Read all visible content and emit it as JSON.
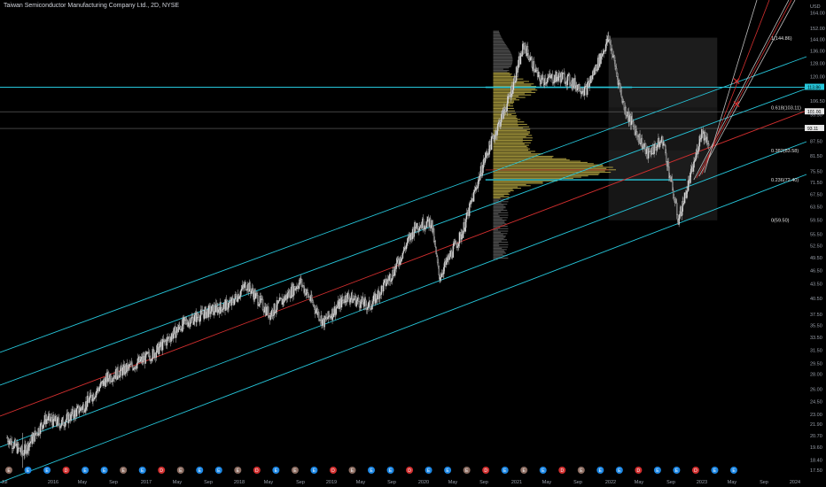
{
  "header": {
    "title": "Taiwan Semiconductor Manufacturing Company Ltd., 2D, NYSE"
  },
  "colors": {
    "background": "#000000",
    "channel": "#26c6da",
    "midline": "#d32f2f",
    "fib_box": "#1a1a1a",
    "volume_profile": "#b5a642",
    "volume_profile_low": "#5a5a5a",
    "candles": "#c8c8c8",
    "tag_cyan": "#26c6da",
    "tag_white": "#e6e6e6",
    "event_blue": "#2962ff",
    "event_red": "#d32f2f"
  },
  "chart_data": {
    "type": "candlestick",
    "title": "Taiwan Semiconductor Manufacturing Company Ltd., 2D, NYSE",
    "y_scale": "log",
    "ylim": [
      17.5,
      170
    ],
    "y_currency_label": "USD",
    "y_ticks": [
      "164.00",
      "152.00",
      "144.00",
      "136.00",
      "128.00",
      "120.00",
      "113.86",
      "106.50",
      "101.00",
      "99.50",
      "93.11",
      "87.50",
      "81.50",
      "75.50",
      "71.50",
      "67.50",
      "63.50",
      "59.50",
      "55.50",
      "52.50",
      "49.50",
      "46.50",
      "43.50",
      "40.50",
      "37.50",
      "35.50",
      "33.50",
      "31.50",
      "29.50",
      "28.00",
      "26.00",
      "24.50",
      "23.00",
      "21.90",
      "20.70",
      "19.60",
      "18.40",
      "17.50"
    ],
    "x_ticks": [
      "Jul",
      "2016",
      "May",
      "Sep",
      "2017",
      "May",
      "Sep",
      "2018",
      "May",
      "Sep",
      "2019",
      "May",
      "Sep",
      "2020",
      "May",
      "Sep",
      "2021",
      "May",
      "Sep",
      "2022",
      "May",
      "Sep",
      "2023",
      "May",
      "Sep",
      "2024"
    ],
    "x_range": [
      "2015-07",
      "2024-01"
    ],
    "price_path": [
      [
        "2015-07",
        20.5
      ],
      [
        "2015-09",
        19.0
      ],
      [
        "2015-12",
        22.5
      ],
      [
        "2016-02",
        22.0
      ],
      [
        "2016-05",
        24.0
      ],
      [
        "2016-08",
        27.5
      ],
      [
        "2016-11",
        29.0
      ],
      [
        "2017-02",
        31.0
      ],
      [
        "2017-06",
        36.0
      ],
      [
        "2017-09",
        38.0
      ],
      [
        "2017-12",
        39.5
      ],
      [
        "2018-02",
        43.5
      ],
      [
        "2018-05",
        37.5
      ],
      [
        "2018-09",
        44.0
      ],
      [
        "2018-12",
        36.0
      ],
      [
        "2019-03",
        41.0
      ],
      [
        "2019-06",
        39.0
      ],
      [
        "2019-09",
        46.0
      ],
      [
        "2019-12",
        58.0
      ],
      [
        "2020-02",
        59.0
      ],
      [
        "2020-03",
        45.0
      ],
      [
        "2020-06",
        56.0
      ],
      [
        "2020-09",
        81.0
      ],
      [
        "2020-12",
        107.0
      ],
      [
        "2021-02",
        140.0
      ],
      [
        "2021-04",
        118.0
      ],
      [
        "2021-07",
        120.0
      ],
      [
        "2021-10",
        112.0
      ],
      [
        "2022-01",
        144.86
      ],
      [
        "2022-03",
        103.0
      ],
      [
        "2022-06",
        82.0
      ],
      [
        "2022-08",
        88.0
      ],
      [
        "2022-10",
        59.5
      ],
      [
        "2022-12",
        78.0
      ],
      [
        "2023-01",
        92.0
      ],
      [
        "2023-02",
        87.0
      ]
    ],
    "horizontal_levels": [
      {
        "label": "113.86",
        "value": 113.86,
        "color": "cyan"
      },
      {
        "label": "101.00",
        "value": 101.0,
        "color": "white"
      },
      {
        "label": "93.11",
        "value": 93.11,
        "color": "white"
      }
    ],
    "fibonacci": [
      {
        "label": "1(144.86)",
        "value": 144.86
      },
      {
        "label": "0.618(103.11)",
        "value": 103.11
      },
      {
        "label": "0.382(83.58)",
        "value": 83.58
      },
      {
        "label": "0.236(72.40)",
        "value": 72.4
      },
      {
        "label": "0(59.50)",
        "value": 59.5
      }
    ],
    "channel": {
      "description": "parallel ascending regression channel",
      "lines": [
        "upper",
        "inner-upper",
        "mid",
        "inner-lower",
        "lower"
      ]
    },
    "volume_profile": {
      "poc_value": 76.0,
      "range": [
        49.0,
        150.0
      ]
    },
    "event_markers": [
      "E",
      "E",
      "E",
      "D",
      "E",
      "E",
      "E",
      "E",
      "D",
      "E",
      "E",
      "E",
      "E",
      "D",
      "E",
      "E",
      "E",
      "D",
      "E",
      "E",
      "E",
      "D",
      "E",
      "E",
      "E",
      "D",
      "E",
      "E",
      "E",
      "D",
      "E",
      "E",
      "E",
      "D",
      "E",
      "E",
      "D",
      "E",
      "E"
    ]
  }
}
